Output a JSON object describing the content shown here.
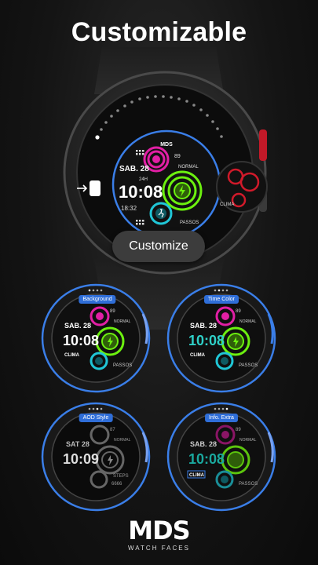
{
  "header": {
    "title": "Customizable"
  },
  "customize_button": {
    "label": "Customize"
  },
  "main_face": {
    "date": "SAB. 28",
    "time": "10:08",
    "format": "24H",
    "status": "NORMAL",
    "top_value": "89",
    "temp": "18:32",
    "steps_label": "PASSOS",
    "logo": "MDS"
  },
  "side_face": {
    "label": "CLIMA"
  },
  "previews": [
    {
      "label": "Background",
      "date": "SAB. 28",
      "time": "10:08",
      "status": "NORMAL",
      "top_value": "89",
      "weather": "CLIMA",
      "steps": "PASSOS"
    },
    {
      "label": "Time Color",
      "date": "SAB. 28",
      "time": "10:08",
      "status": "NORMAL",
      "top_value": "89",
      "weather": "CLIMA",
      "steps": "PASSOS"
    },
    {
      "label": "AOD Style",
      "date": "SAT 28",
      "time": "10:09",
      "status": "NORMAL",
      "top_value": "87",
      "steps": "STEPS",
      "extra": "6666"
    },
    {
      "label": "Info. Extra",
      "date": "SAB. 28",
      "time": "10:08",
      "status": "NORMAL",
      "top_value": "89",
      "weather": "CLIMA",
      "steps": "PASSOS"
    }
  ],
  "brand": {
    "logo": "MDS",
    "subtitle": "WATCH FACES"
  },
  "colors": {
    "magenta": "#e21fa5",
    "green": "#6cf00f",
    "cyan": "#20c6d6",
    "blue_ring": "#3a7ee8",
    "teal_time": "#2fd0c8",
    "red_accent": "#d11a2a"
  },
  "icons": {
    "exit": "arrow-into-door-icon",
    "bolt": "lightning-bolt-icon",
    "runner": "running-person-icon",
    "grid": "app-grid-icon",
    "cloud": "cloud-icon"
  }
}
